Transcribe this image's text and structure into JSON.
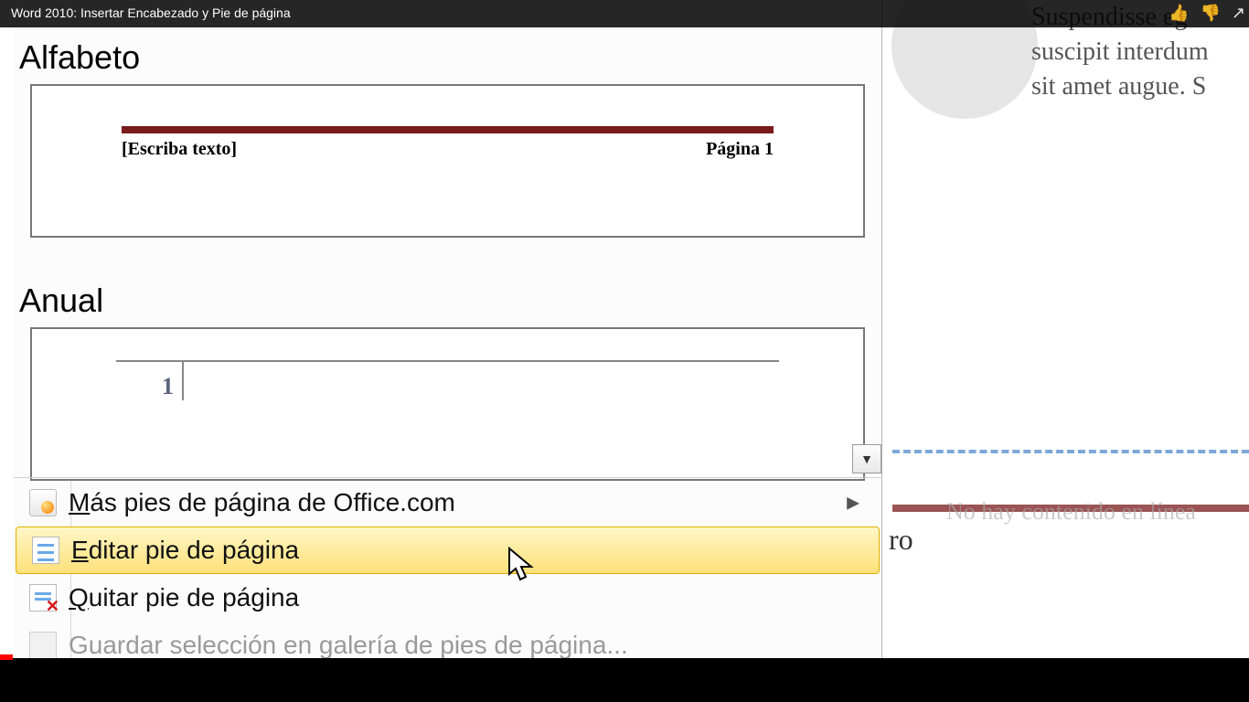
{
  "video": {
    "title": "Word 2010: Insertar Encabezado y Pie de página"
  },
  "gallery": {
    "items": [
      {
        "name": "Alfabeto",
        "placeholder": "[Escriba texto]",
        "page_label": "Página 1"
      },
      {
        "name": "Anual",
        "page_number": "1"
      }
    ]
  },
  "menu": {
    "more_office": "Más pies de página de Office.com",
    "edit": "Editar pie de página",
    "remove": "Quitar pie de página",
    "save_gallery": "Guardar selección en galería de pies de página..."
  },
  "background": {
    "paragraph": "Suspendisse eg\nsuscipit interdum\nsit amet augue. S",
    "no_content": "No hay contenido en línea",
    "ro": "ro"
  }
}
